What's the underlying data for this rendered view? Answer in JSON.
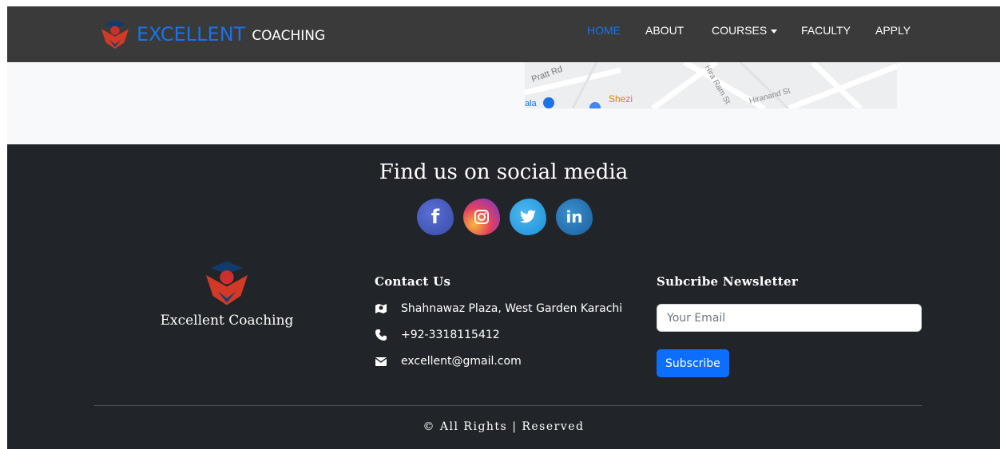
{
  "navbar": {
    "brand_main": "EXCELLENT",
    "brand_sub": "COACHING",
    "links": [
      "HOME",
      "ABOUT",
      "COURSES",
      "FACULTY",
      "APPLY"
    ],
    "active": "HOME"
  },
  "map": {
    "labels": [
      "Pratt Rd",
      "Shezi",
      "Hiranand St",
      "Hira Ram St",
      "ala"
    ]
  },
  "footer": {
    "social_title": "Find us on social media",
    "social": [
      "facebook-icon",
      "instagram-icon",
      "twitter-icon",
      "linkedin-icon"
    ],
    "brand_name": "Excellent Coaching",
    "contact": {
      "heading": "Contact Us",
      "address": "Shahnawaz Plaza, West Garden Karachi",
      "phone": "+92-3318115412",
      "email": "excellent@gmail.com"
    },
    "newsletter": {
      "heading": "Subcribe Newsletter",
      "placeholder": "Your Email",
      "button": "Subscribe"
    },
    "copyright": "© All Rights | Reserved"
  },
  "colors": {
    "accent": "#1a73e8",
    "navbar": "#3a3a3a",
    "footer": "#212529",
    "button": "#0d6efd"
  }
}
